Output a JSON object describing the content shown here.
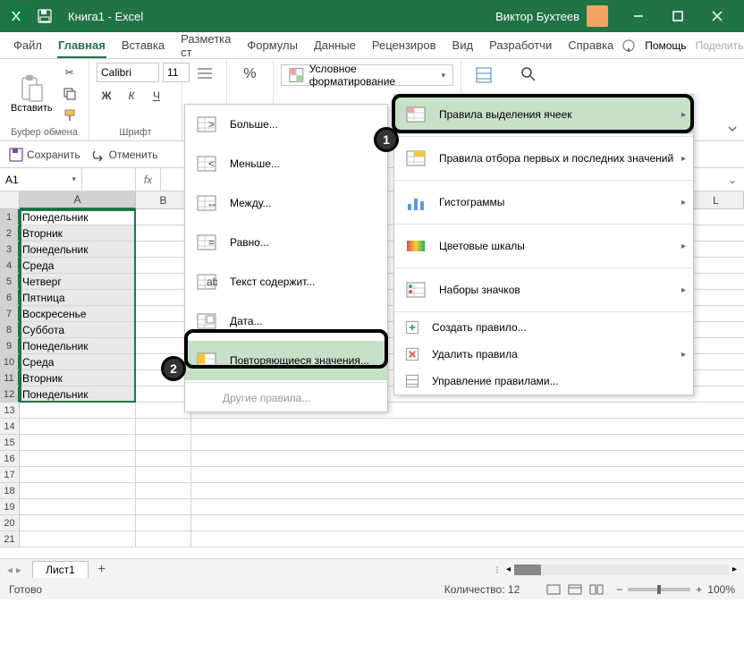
{
  "titlebar": {
    "title": "Книга1 - Excel",
    "user": "Виктор Бухтеев"
  },
  "menubar": {
    "tabs": [
      "Файл",
      "Главная",
      "Вставка",
      "Разметка ст",
      "Формулы",
      "Данные",
      "Рецензиров",
      "Вид",
      "Разработчи",
      "Справка"
    ],
    "active": 1,
    "help": "Помощь",
    "share": "Поделиться"
  },
  "ribbon": {
    "paste": "Вставить",
    "clipboard": "Буфер обмена",
    "font": "Шрифт",
    "fontName": "Calibri",
    "fontSize": "11",
    "condFmt": "Условное форматирование"
  },
  "qat": {
    "save": "Сохранить",
    "undo": "Отменить"
  },
  "namebox": {
    "ref": "A1"
  },
  "columns": [
    "A",
    "B",
    "L"
  ],
  "colWidths": {
    "A": 130,
    "B": 62,
    "L": 62
  },
  "data": {
    "rows": [
      "Понедельник",
      "Вторник",
      "Понедельник",
      "Среда",
      "Четверг",
      "Пятница",
      "Воскресенье",
      "Суббота",
      "Понедельник",
      "Среда",
      "Вторник",
      "Понедельник"
    ]
  },
  "totalRows": 21,
  "sheet": {
    "name": "Лист1"
  },
  "status": {
    "ready": "Готово",
    "count_label": "Количество:",
    "count": "12",
    "zoom": "100%"
  },
  "menu1": {
    "items": [
      {
        "label": "Правила выделения ячеек",
        "arrow": true,
        "hl": true,
        "ico": "hl"
      },
      {
        "label": "Правила отбора первых и последних значений",
        "arrow": true,
        "ico": "top"
      },
      {
        "label": "Гистограммы",
        "arrow": true,
        "ico": "bars"
      },
      {
        "label": "Цветовые шкалы",
        "arrow": true,
        "ico": "scale"
      },
      {
        "label": "Наборы значков",
        "arrow": true,
        "ico": "icons"
      }
    ],
    "small": [
      {
        "label": "Создать правило...",
        "ico": "new"
      },
      {
        "label": "Удалить правила",
        "arrow": true,
        "ico": "clear"
      },
      {
        "label": "Управление правилами...",
        "ico": "manage"
      }
    ]
  },
  "menu2": {
    "items": [
      {
        "label": "Больше...",
        "ico": "gt"
      },
      {
        "label": "Меньше...",
        "ico": "lt"
      },
      {
        "label": "Между...",
        "ico": "between"
      },
      {
        "label": "Равно...",
        "ico": "eq"
      },
      {
        "label": "Текст содержит...",
        "ico": "text"
      },
      {
        "label": "Дата...",
        "ico": "date"
      },
      {
        "label": "Повторяющиеся значения...",
        "ico": "dup",
        "hl": true
      }
    ],
    "other": "Другие правила..."
  }
}
